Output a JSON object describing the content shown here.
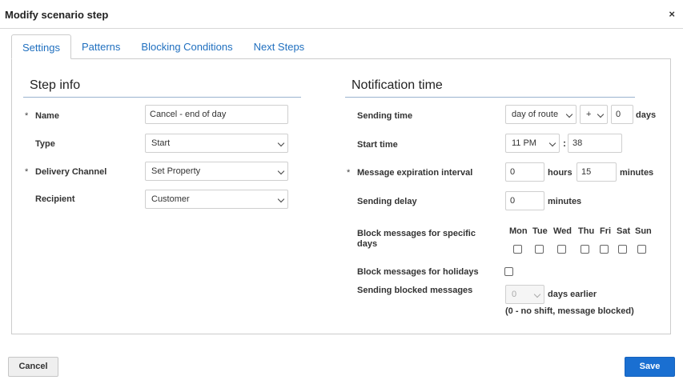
{
  "dialog": {
    "title": "Modify scenario step",
    "close_glyph": "×"
  },
  "tabs": [
    {
      "label": "Settings",
      "active": true
    },
    {
      "label": "Patterns",
      "active": false
    },
    {
      "label": "Blocking Conditions",
      "active": false
    },
    {
      "label": "Next Steps",
      "active": false
    }
  ],
  "step_info": {
    "title": "Step info",
    "required_marker": "*",
    "name_label": "Name",
    "name_value": "Cancel - end of day",
    "type_label": "Type",
    "type_value": "Start",
    "channel_label": "Delivery Channel",
    "channel_value": "Set Property",
    "recipient_label": "Recipient",
    "recipient_value": "Customer"
  },
  "notification": {
    "title": "Notification time",
    "required_marker": "*",
    "sending_time_label": "Sending time",
    "sending_time_base": "day of route",
    "sending_time_sign": "+",
    "sending_time_days": "0",
    "days_unit": "days",
    "start_time_label": "Start time",
    "start_hour": "11 PM",
    "time_separator": ":",
    "start_minute": "38",
    "expiration_label": "Message expiration interval",
    "expiration_hours": "0",
    "hours_unit": "hours",
    "expiration_minutes": "15",
    "minutes_unit": "minutes",
    "delay_label": "Sending delay",
    "delay_value": "0",
    "block_days_label": "Block messages for specific days",
    "days": [
      {
        "label": "Mon",
        "checked": false
      },
      {
        "label": "Tue",
        "checked": false
      },
      {
        "label": "Wed",
        "checked": false
      },
      {
        "label": "Thu",
        "checked": false
      },
      {
        "label": "Fri",
        "checked": false
      },
      {
        "label": "Sat",
        "checked": false
      },
      {
        "label": "Sun",
        "checked": false
      }
    ],
    "block_holidays_label": "Block messages for holidays",
    "block_holidays_checked": false,
    "blocked_label": "Sending blocked messages",
    "blocked_days_value": "0",
    "days_earlier_unit": "days earlier",
    "blocked_note": "(0 - no shift, message blocked)"
  },
  "footer": {
    "cancel_label": "Cancel",
    "save_label": "Save"
  },
  "colors": {
    "accent": "#1a6fd1",
    "tab_text": "#1f6fbf",
    "border": "#cccccc"
  }
}
